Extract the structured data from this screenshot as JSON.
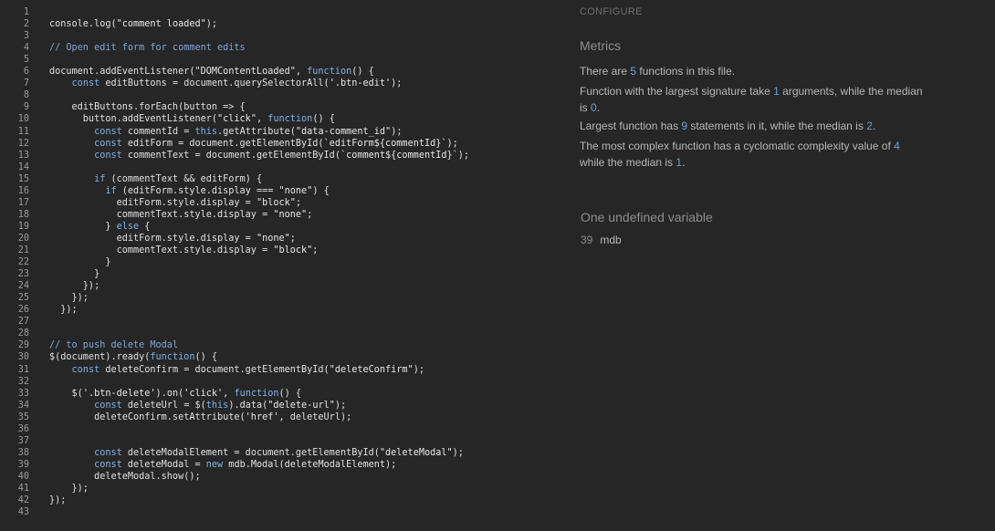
{
  "code": {
    "lines": [
      {
        "n": "1",
        "parts": [
          [
            "",
            ""
          ]
        ]
      },
      {
        "n": "2",
        "parts": [
          [
            "console.log(",
            "p"
          ],
          [
            "\"comment loaded\"",
            "s"
          ],
          [
            ");",
            "p"
          ]
        ]
      },
      {
        "n": "3",
        "parts": [
          [
            "",
            ""
          ]
        ]
      },
      {
        "n": "4",
        "parts": [
          [
            "// Open edit form for comment edits",
            "c"
          ]
        ]
      },
      {
        "n": "5",
        "parts": [
          [
            "",
            ""
          ]
        ]
      },
      {
        "n": "6",
        "parts": [
          [
            "document.addEventListener(",
            "p"
          ],
          [
            "\"DOMContentLoaded\"",
            "s"
          ],
          [
            ", ",
            "p"
          ],
          [
            "function",
            "k"
          ],
          [
            "() {",
            "p"
          ]
        ]
      },
      {
        "n": "7",
        "parts": [
          [
            "    ",
            "p"
          ],
          [
            "const",
            "k"
          ],
          [
            " editButtons = document.querySelectorAll(",
            "p"
          ],
          [
            "'.btn-edit'",
            "s"
          ],
          [
            ");",
            "p"
          ]
        ]
      },
      {
        "n": "8",
        "parts": [
          [
            "",
            ""
          ]
        ]
      },
      {
        "n": "9",
        "parts": [
          [
            "    editButtons.forEach(button => {",
            "p"
          ]
        ]
      },
      {
        "n": "10",
        "parts": [
          [
            "      button.addEventListener(",
            "p"
          ],
          [
            "\"click\"",
            "s"
          ],
          [
            ", ",
            "p"
          ],
          [
            "function",
            "k"
          ],
          [
            "() {",
            "p"
          ]
        ]
      },
      {
        "n": "11",
        "parts": [
          [
            "        ",
            "p"
          ],
          [
            "const",
            "k"
          ],
          [
            " commentId = ",
            "p"
          ],
          [
            "this",
            "k"
          ],
          [
            ".getAttribute(",
            "p"
          ],
          [
            "\"data-comment_id\"",
            "s"
          ],
          [
            ");",
            "p"
          ]
        ]
      },
      {
        "n": "12",
        "parts": [
          [
            "        ",
            "p"
          ],
          [
            "const",
            "k"
          ],
          [
            " editForm = document.getElementById(",
            "p"
          ],
          [
            "`editForm${commentId}`",
            "s"
          ],
          [
            ");",
            "p"
          ]
        ]
      },
      {
        "n": "13",
        "parts": [
          [
            "        ",
            "p"
          ],
          [
            "const",
            "k"
          ],
          [
            " commentText = document.getElementById(",
            "p"
          ],
          [
            "`comment${commentId}`",
            "s"
          ],
          [
            ");",
            "p"
          ]
        ]
      },
      {
        "n": "14",
        "parts": [
          [
            "",
            ""
          ]
        ]
      },
      {
        "n": "15",
        "parts": [
          [
            "        ",
            "p"
          ],
          [
            "if",
            "k"
          ],
          [
            " (commentText && editForm) {",
            "p"
          ]
        ]
      },
      {
        "n": "16",
        "parts": [
          [
            "          ",
            "p"
          ],
          [
            "if",
            "k"
          ],
          [
            " (editForm.style.display === ",
            "p"
          ],
          [
            "\"none\"",
            "s"
          ],
          [
            ") {",
            "p"
          ]
        ]
      },
      {
        "n": "17",
        "parts": [
          [
            "            editForm.style.display = ",
            "p"
          ],
          [
            "\"block\"",
            "s"
          ],
          [
            ";",
            "p"
          ]
        ]
      },
      {
        "n": "18",
        "parts": [
          [
            "            commentText.style.display = ",
            "p"
          ],
          [
            "\"none\"",
            "s"
          ],
          [
            ";",
            "p"
          ]
        ]
      },
      {
        "n": "19",
        "parts": [
          [
            "          } ",
            "p"
          ],
          [
            "else",
            "k"
          ],
          [
            " {",
            "p"
          ]
        ]
      },
      {
        "n": "20",
        "parts": [
          [
            "            editForm.style.display = ",
            "p"
          ],
          [
            "\"none\"",
            "s"
          ],
          [
            ";",
            "p"
          ]
        ]
      },
      {
        "n": "21",
        "parts": [
          [
            "            commentText.style.display = ",
            "p"
          ],
          [
            "\"block\"",
            "s"
          ],
          [
            ";",
            "p"
          ]
        ]
      },
      {
        "n": "22",
        "parts": [
          [
            "          }",
            "p"
          ]
        ]
      },
      {
        "n": "23",
        "parts": [
          [
            "        }",
            "p"
          ]
        ]
      },
      {
        "n": "24",
        "parts": [
          [
            "      });",
            "p"
          ]
        ]
      },
      {
        "n": "25",
        "parts": [
          [
            "    });",
            "p"
          ]
        ]
      },
      {
        "n": "26",
        "parts": [
          [
            "  });",
            "p"
          ]
        ]
      },
      {
        "n": "27",
        "parts": [
          [
            "",
            ""
          ]
        ]
      },
      {
        "n": "28",
        "parts": [
          [
            "",
            ""
          ]
        ]
      },
      {
        "n": "29",
        "parts": [
          [
            "// to push delete Modal",
            "c"
          ]
        ]
      },
      {
        "n": "30",
        "parts": [
          [
            "$(document).ready(",
            "p"
          ],
          [
            "function",
            "k"
          ],
          [
            "() {",
            "p"
          ]
        ]
      },
      {
        "n": "31",
        "parts": [
          [
            "    ",
            "p"
          ],
          [
            "const",
            "k"
          ],
          [
            " deleteConfirm = document.getElementById(",
            "p"
          ],
          [
            "\"deleteConfirm\"",
            "s"
          ],
          [
            ");",
            "p"
          ]
        ]
      },
      {
        "n": "32",
        "parts": [
          [
            "",
            ""
          ]
        ]
      },
      {
        "n": "33",
        "parts": [
          [
            "    $(",
            "p"
          ],
          [
            "'.btn-delete'",
            "s"
          ],
          [
            ").on(",
            "p"
          ],
          [
            "'click'",
            "s"
          ],
          [
            ", ",
            "p"
          ],
          [
            "function",
            "k"
          ],
          [
            "() {",
            "p"
          ]
        ]
      },
      {
        "n": "34",
        "parts": [
          [
            "        ",
            "p"
          ],
          [
            "const",
            "k"
          ],
          [
            " deleteUrl = $(",
            "p"
          ],
          [
            "this",
            "k"
          ],
          [
            ").data(",
            "p"
          ],
          [
            "\"delete-url\"",
            "s"
          ],
          [
            ");",
            "p"
          ]
        ]
      },
      {
        "n": "35",
        "parts": [
          [
            "        deleteConfirm.setAttribute(",
            "p"
          ],
          [
            "'href'",
            "s"
          ],
          [
            ", deleteUrl);",
            "p"
          ]
        ]
      },
      {
        "n": "36",
        "parts": [
          [
            "",
            ""
          ]
        ]
      },
      {
        "n": "37",
        "parts": [
          [
            "",
            ""
          ]
        ]
      },
      {
        "n": "38",
        "parts": [
          [
            "        ",
            "p"
          ],
          [
            "const",
            "k"
          ],
          [
            " deleteModalElement = document.getElementById(",
            "p"
          ],
          [
            "\"deleteModal\"",
            "s"
          ],
          [
            ");",
            "p"
          ]
        ]
      },
      {
        "n": "39",
        "parts": [
          [
            "        ",
            "p"
          ],
          [
            "const",
            "k"
          ],
          [
            " deleteModal = ",
            "p"
          ],
          [
            "new",
            "k"
          ],
          [
            " mdb.Modal(deleteModalElement);",
            "p"
          ]
        ]
      },
      {
        "n": "40",
        "parts": [
          [
            "        deleteModal.show();",
            "p"
          ]
        ]
      },
      {
        "n": "41",
        "parts": [
          [
            "    });",
            "p"
          ]
        ]
      },
      {
        "n": "42",
        "parts": [
          [
            "});",
            "p"
          ]
        ]
      },
      {
        "n": "43",
        "parts": [
          [
            "",
            ""
          ]
        ]
      }
    ]
  },
  "side": {
    "configure_label": "CONFIGURE",
    "metrics_title": "Metrics",
    "metric1": {
      "a": "There are ",
      "n1": "5",
      "b": " functions in this file."
    },
    "metric2": {
      "a": "Function with the largest signature take ",
      "n1": "1",
      "b": " arguments, while the median is ",
      "n2": "0",
      "c": "."
    },
    "metric3": {
      "a": "Largest function has ",
      "n1": "9",
      "b": " statements in it, while the median is ",
      "n2": "2",
      "c": "."
    },
    "metric4": {
      "a": "The most complex function has a cyclomatic complexity value of ",
      "n1": "4",
      "b": " while the median is ",
      "n2": "1",
      "c": "."
    },
    "undefined_title": "One undefined variable",
    "undefined_line": "39",
    "undefined_name": "mdb"
  },
  "colors": {
    "background": "#262626",
    "accent_number": "#6aa2d8"
  }
}
